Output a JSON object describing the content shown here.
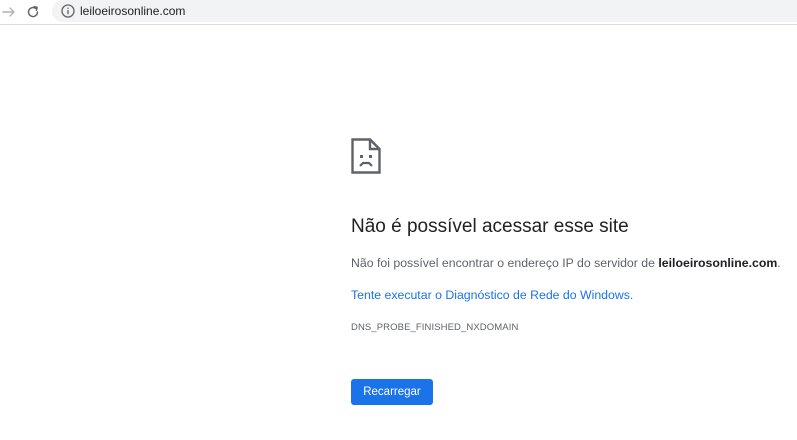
{
  "toolbar": {
    "back_icon": "arrow-right-icon",
    "reload_icon": "reload-icon",
    "info_icon": "info-icon",
    "url": "leiloeirosonline.com"
  },
  "error": {
    "icon": "sad-document-icon",
    "title": "Não é possível acessar esse site",
    "desc_prefix": "Não foi possível encontrar o endereço IP do servidor de ",
    "desc_domain": "leiloeirosonline.com",
    "desc_suffix": ".",
    "diagnostic_link": "Tente executar o Diagnóstico de Rede do Windows.",
    "code": "DNS_PROBE_FINISHED_NXDOMAIN",
    "reload_label": "Recarregar"
  },
  "colors": {
    "accent": "#1a73e8",
    "text_primary": "#202124",
    "text_secondary": "#5f6368"
  }
}
